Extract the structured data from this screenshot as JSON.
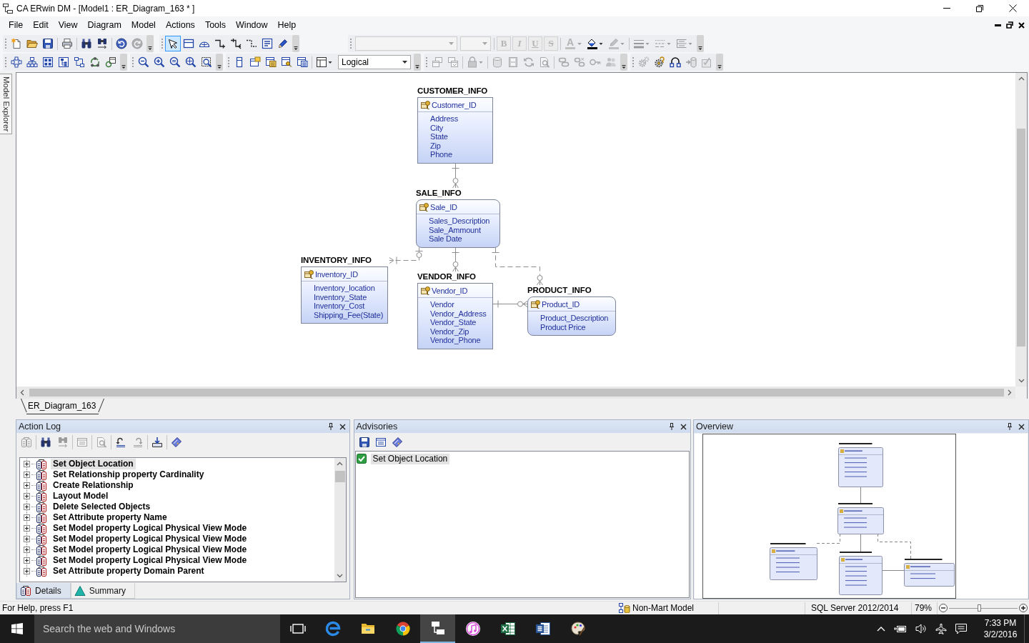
{
  "window": {
    "title": "CA ERwin DM - [Model1 : ER_Diagram_163 * ]"
  },
  "menu": [
    "File",
    "Edit",
    "View",
    "Diagram",
    "Model",
    "Actions",
    "Tools",
    "Window",
    "Help"
  ],
  "toolbar_rows": [
    [
      {
        "items": [
          {
            "kind": "new",
            "disabled": false
          },
          {
            "kind": "open",
            "disabled": false
          },
          {
            "kind": "save",
            "disabled": false
          },
          {
            "kind": "separator"
          },
          {
            "kind": "print",
            "disabled": false
          },
          {
            "kind": "separator"
          },
          {
            "kind": "find",
            "disabled": false
          },
          {
            "kind": "replace",
            "disabled": false
          },
          {
            "kind": "separator"
          },
          {
            "kind": "undo",
            "disabled": false
          },
          {
            "kind": "redo",
            "disabled": true
          }
        ]
      },
      {
        "items": [
          {
            "kind": "pointer",
            "selected": true
          },
          {
            "kind": "entity",
            "selected": false
          },
          {
            "kind": "view",
            "selected": false
          },
          {
            "kind": "rel-identifying",
            "selected": false
          },
          {
            "kind": "rel-many",
            "selected": false
          },
          {
            "kind": "rel-nonidentifying",
            "selected": false
          },
          {
            "kind": "text",
            "selected": false
          },
          {
            "kind": "pen",
            "selected": false
          }
        ]
      },
      {
        "items": [
          {
            "kind": "font-combo",
            "disabled": true
          },
          {
            "kind": "size-combo",
            "disabled": true
          },
          {
            "kind": "separator"
          },
          {
            "kind": "bold",
            "label": "B",
            "disabled": true
          },
          {
            "kind": "italic",
            "label": "I",
            "disabled": true
          },
          {
            "kind": "underline",
            "label": "U",
            "disabled": true
          },
          {
            "kind": "strike",
            "label": "S",
            "disabled": true
          },
          {
            "kind": "separator"
          },
          {
            "kind": "font-color",
            "label": "A",
            "disabled": true
          },
          {
            "kind": "fill-color",
            "disabled": false
          },
          {
            "kind": "line-color",
            "disabled": true
          },
          {
            "kind": "separator"
          },
          {
            "kind": "line-weight",
            "disabled": true
          },
          {
            "kind": "line-style",
            "disabled": true
          },
          {
            "kind": "line-spacing",
            "disabled": true
          }
        ]
      }
    ],
    [
      {
        "items": [
          {
            "kind": "layout-circle",
            "disabled": false
          },
          {
            "kind": "layout-hierarchy",
            "disabled": false
          },
          {
            "kind": "layout-cluster",
            "disabled": false
          },
          {
            "kind": "layout-tree",
            "disabled": false
          },
          {
            "kind": "layout-orthogonal",
            "disabled": false
          },
          {
            "kind": "layout-cycle",
            "disabled": false
          },
          {
            "kind": "layout-window",
            "disabled": false
          }
        ]
      },
      {
        "items": [
          {
            "kind": "zoom-out",
            "disabled": false
          },
          {
            "kind": "zoom-in",
            "disabled": false
          },
          {
            "kind": "zoom-normal",
            "disabled": false
          },
          {
            "kind": "zoom-fit",
            "disabled": false
          },
          {
            "kind": "zoom-area",
            "disabled": false
          }
        ]
      },
      {
        "items": [
          {
            "kind": "display-column",
            "disabled": false
          },
          {
            "kind": "display-note",
            "disabled": false
          },
          {
            "kind": "display-table",
            "disabled": false
          },
          {
            "kind": "display-key",
            "disabled": false
          },
          {
            "kind": "display-list",
            "disabled": false
          },
          {
            "kind": "separator"
          },
          {
            "kind": "layout-panes",
            "disabled": false
          },
          {
            "kind": "view-combo",
            "value": "Logical",
            "disabled": false
          }
        ]
      },
      {
        "items": [
          {
            "kind": "stack-a",
            "disabled": true
          },
          {
            "kind": "stack-b",
            "disabled": true
          },
          {
            "kind": "separator"
          },
          {
            "kind": "lock",
            "disabled": true
          },
          {
            "kind": "separator"
          },
          {
            "kind": "database",
            "disabled": true
          },
          {
            "kind": "film",
            "disabled": true
          },
          {
            "kind": "refresh",
            "disabled": true
          },
          {
            "kind": "page-search",
            "disabled": true
          },
          {
            "kind": "separator"
          },
          {
            "kind": "link",
            "disabled": true
          },
          {
            "kind": "unlink",
            "disabled": true
          },
          {
            "kind": "key",
            "disabled": true
          },
          {
            "kind": "people",
            "disabled": true
          }
        ]
      },
      {
        "items": [
          {
            "kind": "gear",
            "disabled": true
          },
          {
            "kind": "gear-key",
            "disabled": false
          },
          {
            "kind": "arc-nodes",
            "disabled": false
          },
          {
            "kind": "database-arrow",
            "disabled": true
          },
          {
            "kind": "checklist",
            "disabled": true
          }
        ]
      }
    ]
  ],
  "side_tabs": [
    {
      "label": "Model Explorer"
    }
  ],
  "diagram": {
    "entities": [
      {
        "name": "CUSTOMER_INFO",
        "key": "Customer_ID",
        "attributes": [
          "Address",
          "City",
          "State",
          "Zip",
          "Phone"
        ],
        "dependent": false
      },
      {
        "name": "SALE_INFO",
        "key": "Sale_ID",
        "attributes": [
          "Sales_Description",
          "Sale_Ammount",
          "Sale Date"
        ],
        "dependent": true
      },
      {
        "name": "INVENTORY_INFO",
        "key": "Inventory_ID",
        "attributes": [
          "Inventory_location",
          "Inventory_State",
          "Inventory_Cost",
          "Shipping_Fee(State)"
        ],
        "dependent": false
      },
      {
        "name": "VENDOR_INFO",
        "key": "Vendor_ID",
        "attributes": [
          "Vendor",
          "Vendor_Address",
          "Vendor_State",
          "Vendor_Zip",
          "Vendor_Phone"
        ],
        "dependent": false
      },
      {
        "name": "PRODUCT_INFO",
        "key": "Product_ID",
        "attributes": [
          "Product_Description",
          "Product Price"
        ],
        "dependent": true
      }
    ],
    "relationships": [
      {
        "kind": "identifying",
        "parent_optional": false,
        "child_optional": true
      },
      {
        "kind": "non-identifying",
        "parent_optional": true,
        "child_optional": false
      },
      {
        "kind": "identifying",
        "parent_optional": false,
        "child_optional": true
      },
      {
        "kind": "non-identifying",
        "parent_optional": false,
        "child_optional": true
      },
      {
        "kind": "identifying",
        "parent_optional": false,
        "child_optional": true
      }
    ]
  },
  "diagram_tabs": [
    {
      "label": "ER_Diagram_163"
    }
  ],
  "action_log": {
    "title": "Action Log",
    "toolbar": [
      {
        "kind": "details",
        "disabled": true
      },
      {
        "kind": "separator"
      },
      {
        "kind": "find",
        "disabled": false
      },
      {
        "kind": "replace",
        "disabled": true
      },
      {
        "kind": "separator"
      },
      {
        "kind": "list-page",
        "disabled": true
      },
      {
        "kind": "separator"
      },
      {
        "kind": "page-search",
        "disabled": true
      },
      {
        "kind": "separator"
      },
      {
        "kind": "undo-steps",
        "disabled": false
      },
      {
        "kind": "redo-steps",
        "disabled": true
      },
      {
        "kind": "separator"
      },
      {
        "kind": "tray-in",
        "disabled": false
      },
      {
        "kind": "separator"
      },
      {
        "kind": "book",
        "disabled": false
      }
    ],
    "entries": [
      {
        "label": "Set Object Location",
        "selected": true,
        "expanded": false
      },
      {
        "label": "Set Relationship property Cardinality",
        "selected": false,
        "expanded": false
      },
      {
        "label": "Create Relationship",
        "selected": false,
        "expanded": false
      },
      {
        "label": "Layout Model",
        "selected": false,
        "expanded": false
      },
      {
        "label": "Delete Selected Objects",
        "selected": false,
        "expanded": false
      },
      {
        "label": "Set Attribute property Name",
        "selected": false,
        "expanded": false
      },
      {
        "label": "Set Model property Logical Physical View Mode",
        "selected": false,
        "expanded": false
      },
      {
        "label": "Set Model property Logical Physical View Mode",
        "selected": false,
        "expanded": false
      },
      {
        "label": "Set Model property Logical Physical View Mode",
        "selected": false,
        "expanded": false
      },
      {
        "label": "Set Model property Logical Physical View Mode",
        "selected": false,
        "expanded": false
      },
      {
        "label": "Set Attribute property Domain Parent",
        "selected": false,
        "expanded": false
      }
    ],
    "tabs": [
      {
        "label": "Details",
        "kind": "details",
        "selected": true
      },
      {
        "label": "Summary",
        "kind": "summary",
        "selected": false
      }
    ]
  },
  "advisories": {
    "title": "Advisories",
    "toolbar": [
      {
        "kind": "save",
        "disabled": false
      },
      {
        "kind": "list-page",
        "disabled": false
      },
      {
        "kind": "book",
        "disabled": false
      }
    ],
    "entries": [
      {
        "label": "Set Object Location",
        "selected": true
      }
    ]
  },
  "overview": {
    "title": "Overview"
  },
  "status_bar": {
    "help": "For Help, press F1",
    "model_type": "Non-Mart Model",
    "database": "SQL Server 2012/2014",
    "zoom": "79%",
    "zoom_slider": {
      "level": 0.44
    }
  },
  "taskbar": {
    "search": {
      "placeholder": "Search the web and Windows"
    },
    "apps": [
      {
        "kind": "task-view",
        "selected": false
      },
      {
        "kind": "edge",
        "selected": false
      },
      {
        "kind": "explorer",
        "selected": false
      },
      {
        "kind": "chrome",
        "selected": false
      },
      {
        "kind": "erwin",
        "selected": true
      },
      {
        "kind": "itunes",
        "selected": false
      },
      {
        "kind": "excel",
        "selected": false
      },
      {
        "kind": "word",
        "selected": false
      },
      {
        "kind": "paint",
        "selected": false
      }
    ],
    "clock": {
      "time": "7:33 PM",
      "date": "3/2/2016"
    }
  }
}
